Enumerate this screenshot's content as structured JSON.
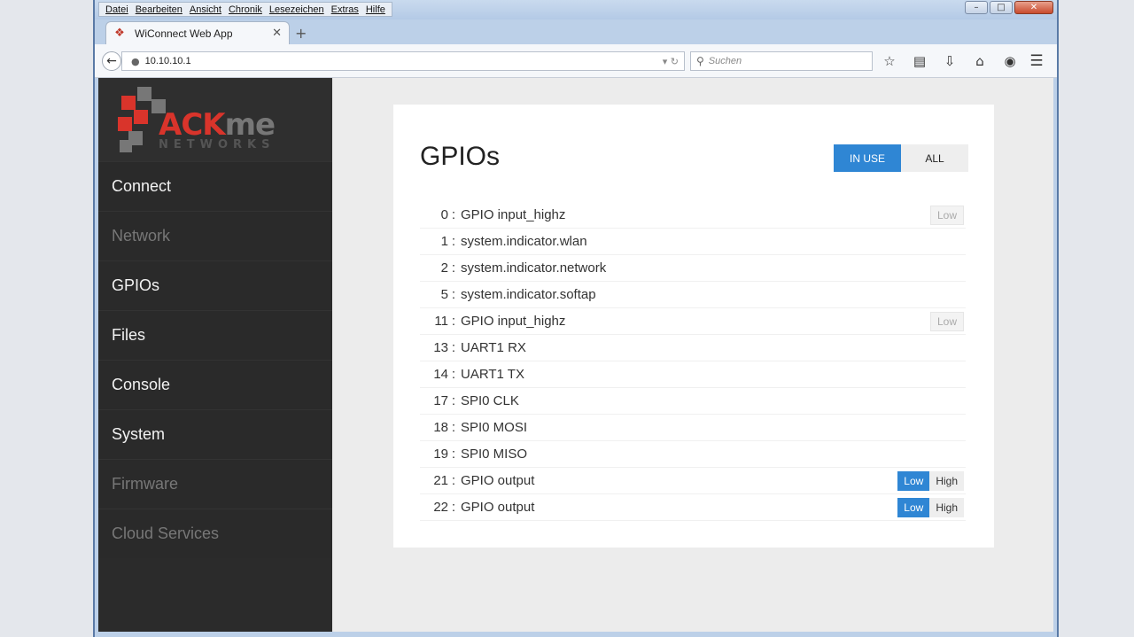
{
  "browser": {
    "menu": [
      "Datei",
      "Bearbeiten",
      "Ansicht",
      "Chronik",
      "Lesezeichen",
      "Extras",
      "Hilfe"
    ],
    "tab_title": "WiConnect Web App",
    "url": "10.10.10.1",
    "search_placeholder": "Suchen"
  },
  "logo": {
    "brand_primary": "ACK",
    "brand_secondary": "me",
    "brand_sub": "NETWORKS"
  },
  "sidebar": {
    "items": [
      {
        "label": "Connect",
        "enabled": true
      },
      {
        "label": "Network",
        "enabled": false
      },
      {
        "label": "GPIOs",
        "enabled": true
      },
      {
        "label": "Files",
        "enabled": true
      },
      {
        "label": "Console",
        "enabled": true
      },
      {
        "label": "System",
        "enabled": true
      },
      {
        "label": "Firmware",
        "enabled": false
      },
      {
        "label": "Cloud Services",
        "enabled": false
      }
    ]
  },
  "main": {
    "title": "GPIOs",
    "filter": {
      "in_use": "IN USE",
      "all": "ALL",
      "selected": "IN USE"
    },
    "gpios": [
      {
        "num": "0",
        "label": "GPIO input_highz",
        "controls": "readonly",
        "state": "Low"
      },
      {
        "num": "1",
        "label": "system.indicator.wlan",
        "controls": "none"
      },
      {
        "num": "2",
        "label": "system.indicator.network",
        "controls": "none"
      },
      {
        "num": "5",
        "label": "system.indicator.softap",
        "controls": "none"
      },
      {
        "num": "11",
        "label": "GPIO input_highz",
        "controls": "readonly",
        "state": "Low"
      },
      {
        "num": "13",
        "label": "UART1 RX",
        "controls": "none"
      },
      {
        "num": "14",
        "label": "UART1 TX",
        "controls": "none"
      },
      {
        "num": "17",
        "label": "SPI0 CLK",
        "controls": "none"
      },
      {
        "num": "18",
        "label": "SPI0 MOSI",
        "controls": "none"
      },
      {
        "num": "19",
        "label": "SPI0 MISO",
        "controls": "none"
      },
      {
        "num": "21",
        "label": "GPIO output",
        "controls": "toggle",
        "low": "Low",
        "high": "High",
        "state": "Low"
      },
      {
        "num": "22",
        "label": "GPIO output",
        "controls": "toggle",
        "low": "Low",
        "high": "High",
        "state": "Low"
      }
    ]
  },
  "colors": {
    "accent": "#2f86d4",
    "sidebar_bg": "#2b2b2b",
    "brand_red": "#d9342b"
  }
}
